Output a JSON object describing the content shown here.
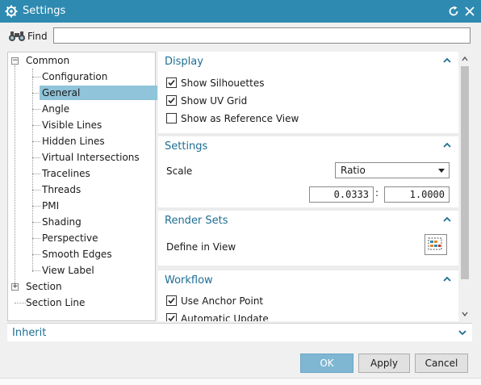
{
  "window": {
    "title": "Settings"
  },
  "find": {
    "label": "Find",
    "value": ""
  },
  "tree": {
    "items": [
      {
        "label": "Common",
        "expander": "−"
      },
      {
        "label": "Configuration"
      },
      {
        "label": "General",
        "selected": true
      },
      {
        "label": "Angle"
      },
      {
        "label": "Visible Lines"
      },
      {
        "label": "Hidden Lines"
      },
      {
        "label": "Virtual Intersections"
      },
      {
        "label": "Tracelines"
      },
      {
        "label": "Threads"
      },
      {
        "label": "PMI"
      },
      {
        "label": "Shading"
      },
      {
        "label": "Perspective"
      },
      {
        "label": "Smooth Edges"
      },
      {
        "label": "View Label"
      },
      {
        "label": "Section",
        "expander": "+"
      },
      {
        "label": "Section Line"
      }
    ]
  },
  "display": {
    "heading": "Display",
    "options": [
      {
        "label": "Show Silhouettes",
        "checked": true
      },
      {
        "label": "Show UV Grid",
        "checked": true
      },
      {
        "label": "Show as Reference View",
        "checked": false
      }
    ]
  },
  "settings": {
    "heading": "Settings",
    "scale_label": "Scale",
    "scale_mode": "Ratio",
    "numerator": "0.0333",
    "separator": ":",
    "denominator": "1.0000"
  },
  "render_sets": {
    "heading": "Render Sets",
    "define_label": "Define in View"
  },
  "workflow": {
    "heading": "Workflow",
    "options": [
      {
        "label": "Use Anchor Point",
        "checked": true
      },
      {
        "label": "Automatic Update",
        "checked": true
      }
    ]
  },
  "inherit": {
    "label": "Inherit"
  },
  "buttons": {
    "ok": "OK",
    "apply": "Apply",
    "cancel": "Cancel"
  },
  "colors": {
    "titlebar": "#2e8ab0",
    "accent_text": "#1e6e94",
    "selection": "#8fc4da",
    "ok_button": "#7fb7d3"
  }
}
